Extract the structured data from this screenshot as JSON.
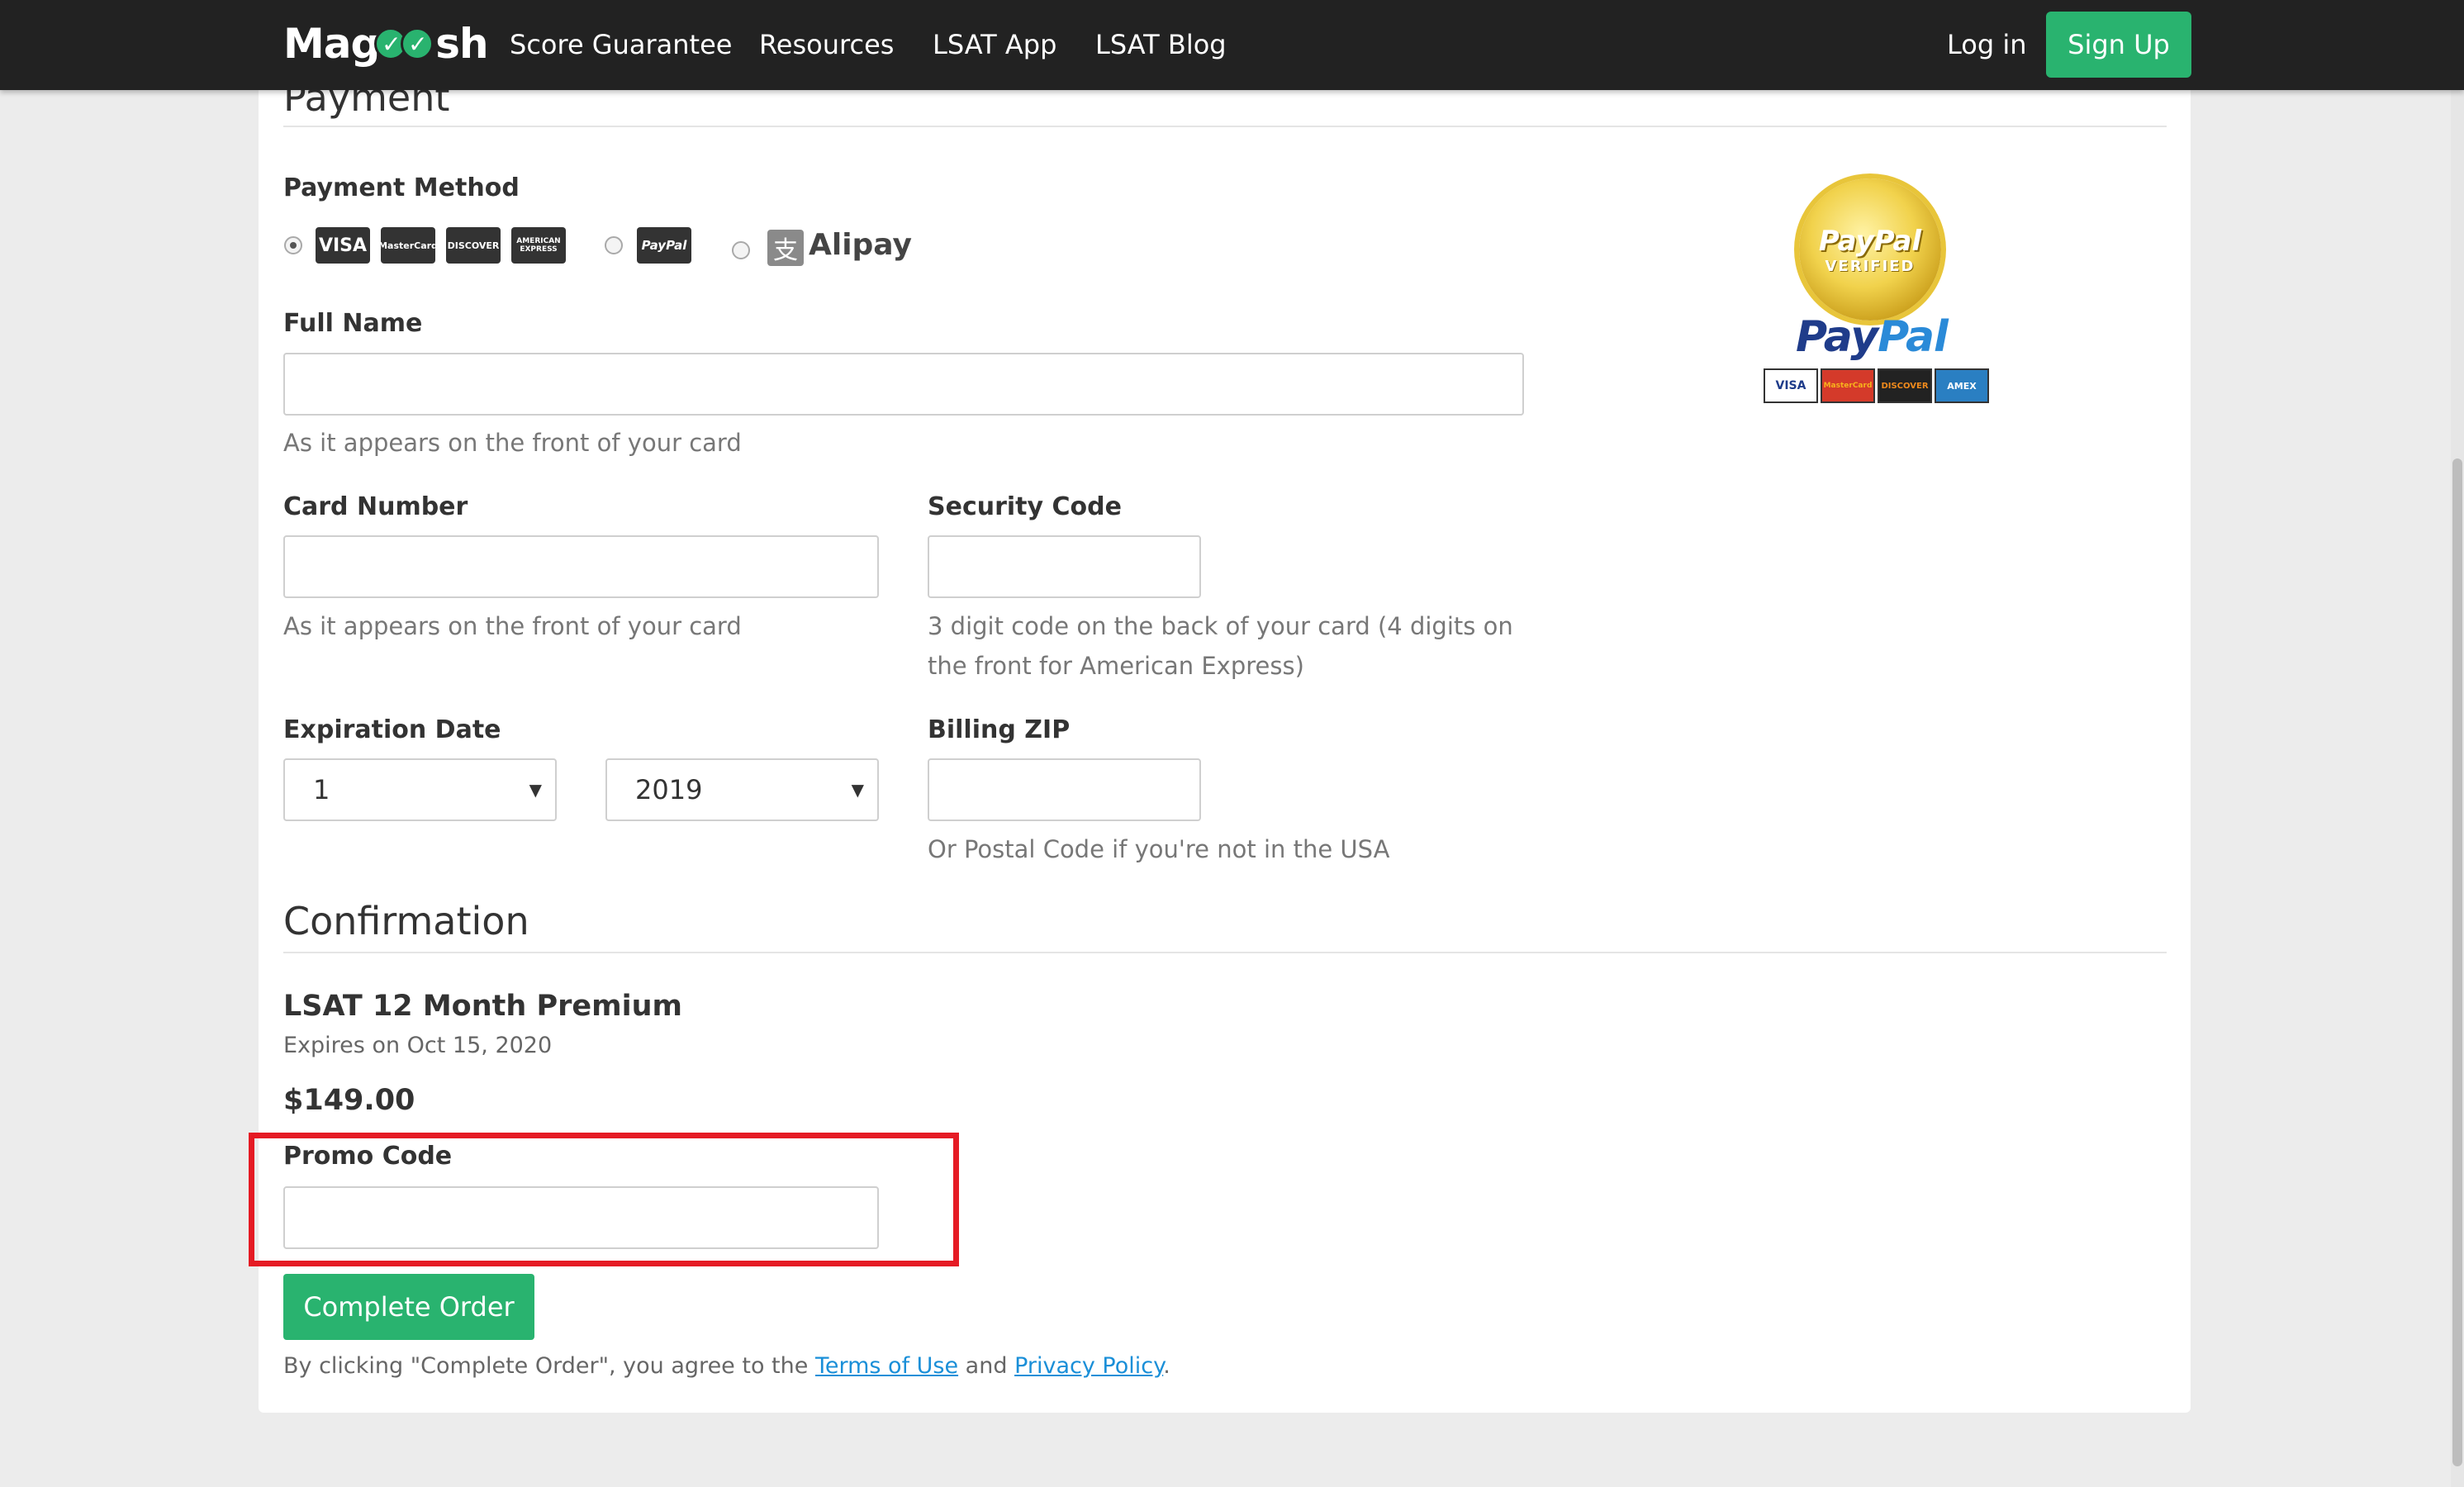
{
  "nav": {
    "logo_prefix": "Mag",
    "logo_suffix": "sh",
    "links": [
      "Score Guarantee",
      "Resources",
      "LSAT App",
      "LSAT Blog"
    ],
    "login": "Log in",
    "signup": "Sign Up"
  },
  "payment": {
    "title": "Payment",
    "method_label": "Payment Method",
    "cards": [
      "VISA",
      "MasterCard",
      "DISCOVER",
      "AMERICAN EXPRESS"
    ],
    "paypal_label": "PayPal",
    "alipay_label": "Alipay",
    "full_name_label": "Full Name",
    "full_name_help": "As it appears on the front of your card",
    "card_number_label": "Card Number",
    "card_number_help": "As it appears on the front of your card",
    "security_code_label": "Security Code",
    "security_code_help_1": "3 digit code on the back of your card (4 digits on",
    "security_code_help_2": "the front for American Express)",
    "expiration_label": "Expiration Date",
    "exp_month": "1",
    "exp_year": "2019",
    "zip_label": "Billing ZIP",
    "zip_help": "Or Postal Code if you're not in the USA"
  },
  "paypal_badge": {
    "seal_top": "PayPal",
    "seal_bottom": "VERIFIED",
    "wordmark_a": "Pay",
    "wordmark_b": "Pal",
    "mini_cards": [
      "VISA",
      "MasterCard",
      "DISCOVER",
      "AMEX"
    ]
  },
  "confirmation": {
    "title": "Confirmation",
    "product": "LSAT 12 Month Premium",
    "expires": "Expires on Oct 15, 2020",
    "price": "$149.00",
    "promo_label": "Promo Code",
    "complete_button": "Complete Order",
    "legal_prefix": "By clicking \"Complete Order\", you agree to the ",
    "terms": "Terms of Use",
    "legal_and": " and ",
    "privacy": "Privacy Policy",
    "legal_end": "."
  },
  "colors": {
    "brand_green": "#29b36f",
    "nav_bg": "#222222",
    "highlight_red": "#e51b24",
    "link_blue": "#1a8fd8"
  }
}
